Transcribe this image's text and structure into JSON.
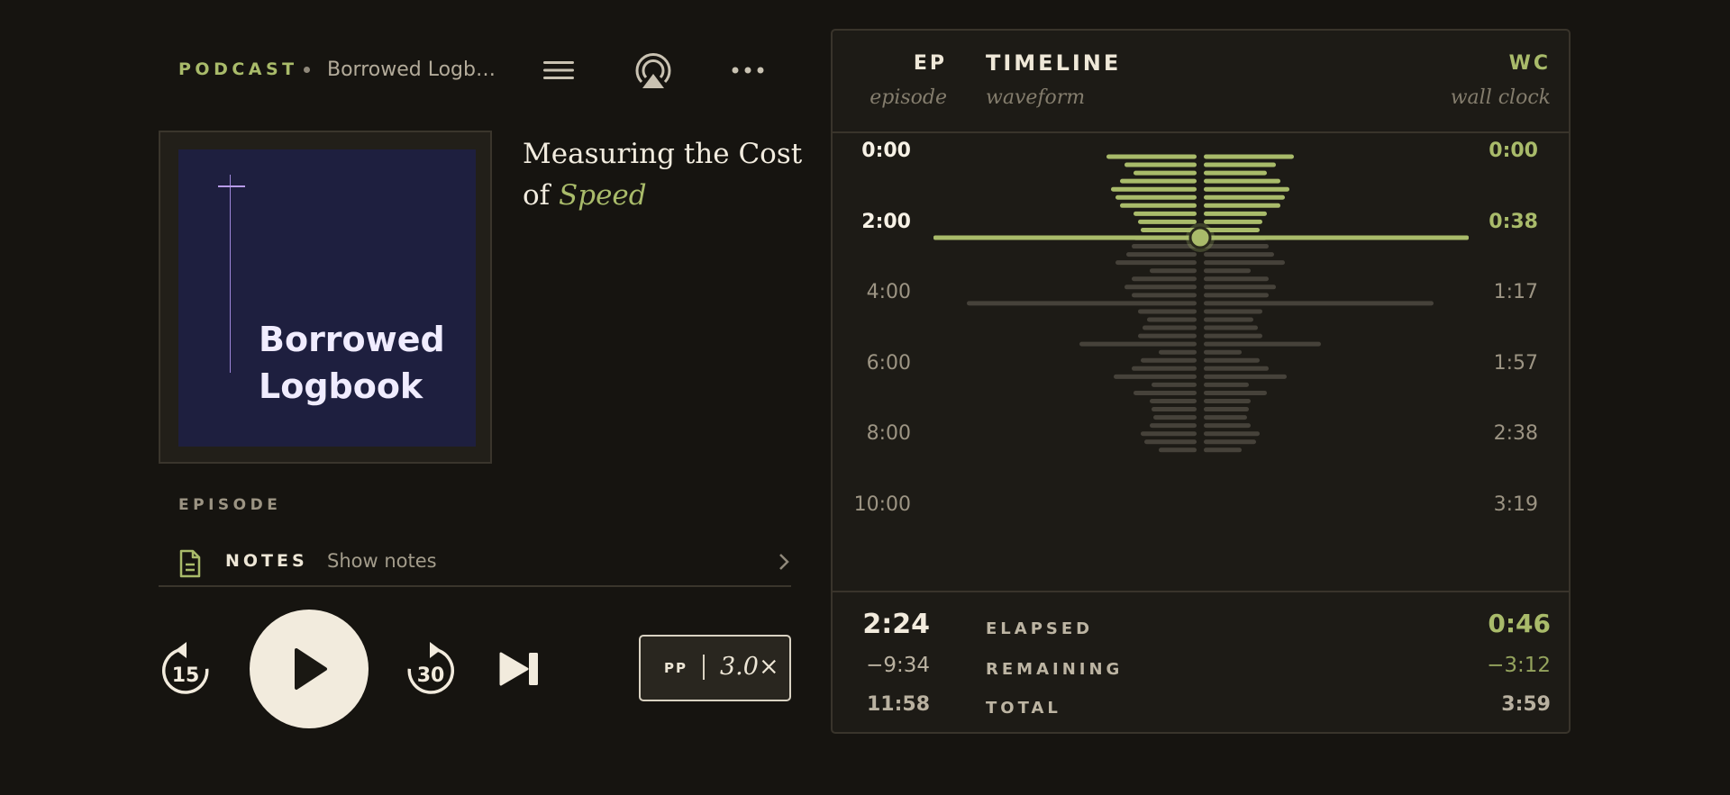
{
  "header": {
    "section_label": "PODCAST",
    "show_name": "Borrowed Logb…"
  },
  "icons": {
    "menu": "hamburger-menu-icon",
    "airplay": "airplay-icon",
    "more": "more-horizontal-icon",
    "notes": "document-icon",
    "chevron": "chevron-right-icon"
  },
  "artwork": {
    "title_line1": "Borrowed",
    "title_line2": "Logbook",
    "bg_color": "#1e1f3f",
    "accent_color": "#b89be8"
  },
  "episode": {
    "title_plain": "Measuring the Cost of ",
    "title_accent": "Speed",
    "section_label": "EPISODE"
  },
  "notes": {
    "label": "NOTES",
    "sub": "Show notes"
  },
  "controls": {
    "rewind_seconds": "15",
    "forward_seconds": "30",
    "speed_prefix": "PP",
    "speed_value": "3.0×"
  },
  "timeline": {
    "ep_label": "EP",
    "ep_sub": "episode",
    "title": "TIMELINE",
    "title_sub": "waveform",
    "wc_label": "WC",
    "wc_sub": "wall clock",
    "ticks": [
      {
        "ep": "0:00",
        "wc": "0:00",
        "passed": true
      },
      {
        "ep": "2:00",
        "wc": "0:38",
        "passed": true
      },
      {
        "ep": "4:00",
        "wc": "1:17",
        "passed": false
      },
      {
        "ep": "6:00",
        "wc": "1:57",
        "passed": false
      },
      {
        "ep": "8:00",
        "wc": "2:38",
        "passed": false
      },
      {
        "ep": "10:00",
        "wc": "3:19",
        "passed": false
      }
    ],
    "playhead_fraction": 0.2,
    "accent_color": "#a9bb6a"
  },
  "stats": {
    "elapsed_ep": "2:24",
    "elapsed_label": "ELAPSED",
    "elapsed_wc": "0:46",
    "remaining_ep": "−9:34",
    "remaining_label": "REMAINING",
    "remaining_wc": "−3:12",
    "total_ep": "11:58",
    "total_label": "TOTAL",
    "total_wc": "3:59"
  }
}
